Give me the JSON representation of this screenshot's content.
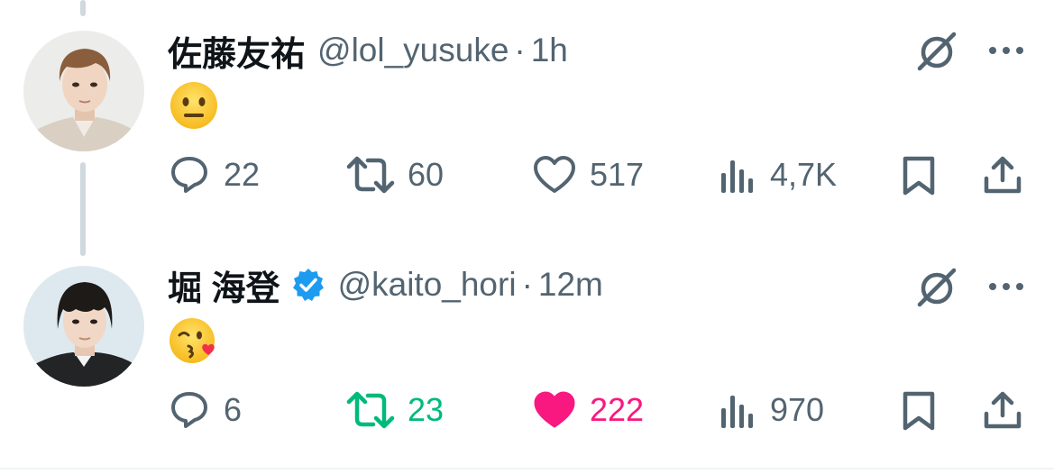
{
  "colors": {
    "text_secondary": "#536471",
    "repost_active": "#00ba7c",
    "like_active": "#f91880",
    "verified": "#1d9bf0",
    "thread_line": "#cfd9de"
  },
  "tweets": [
    {
      "display_name": "佐藤友祐",
      "handle": "@lol_yusuke",
      "separator": "·",
      "time": "1h",
      "verified": false,
      "emoji": "neutral-face",
      "replies": "22",
      "reposts": "60",
      "likes": "517",
      "views": "4,7K",
      "reposted": false,
      "liked": false
    },
    {
      "display_name": "堀 海登",
      "handle": "@kaito_hori",
      "separator": "·",
      "time": "12m",
      "verified": true,
      "emoji": "face-blowing-a-kiss",
      "replies": "6",
      "reposts": "23",
      "likes": "222",
      "views": "970",
      "reposted": true,
      "liked": true
    }
  ]
}
